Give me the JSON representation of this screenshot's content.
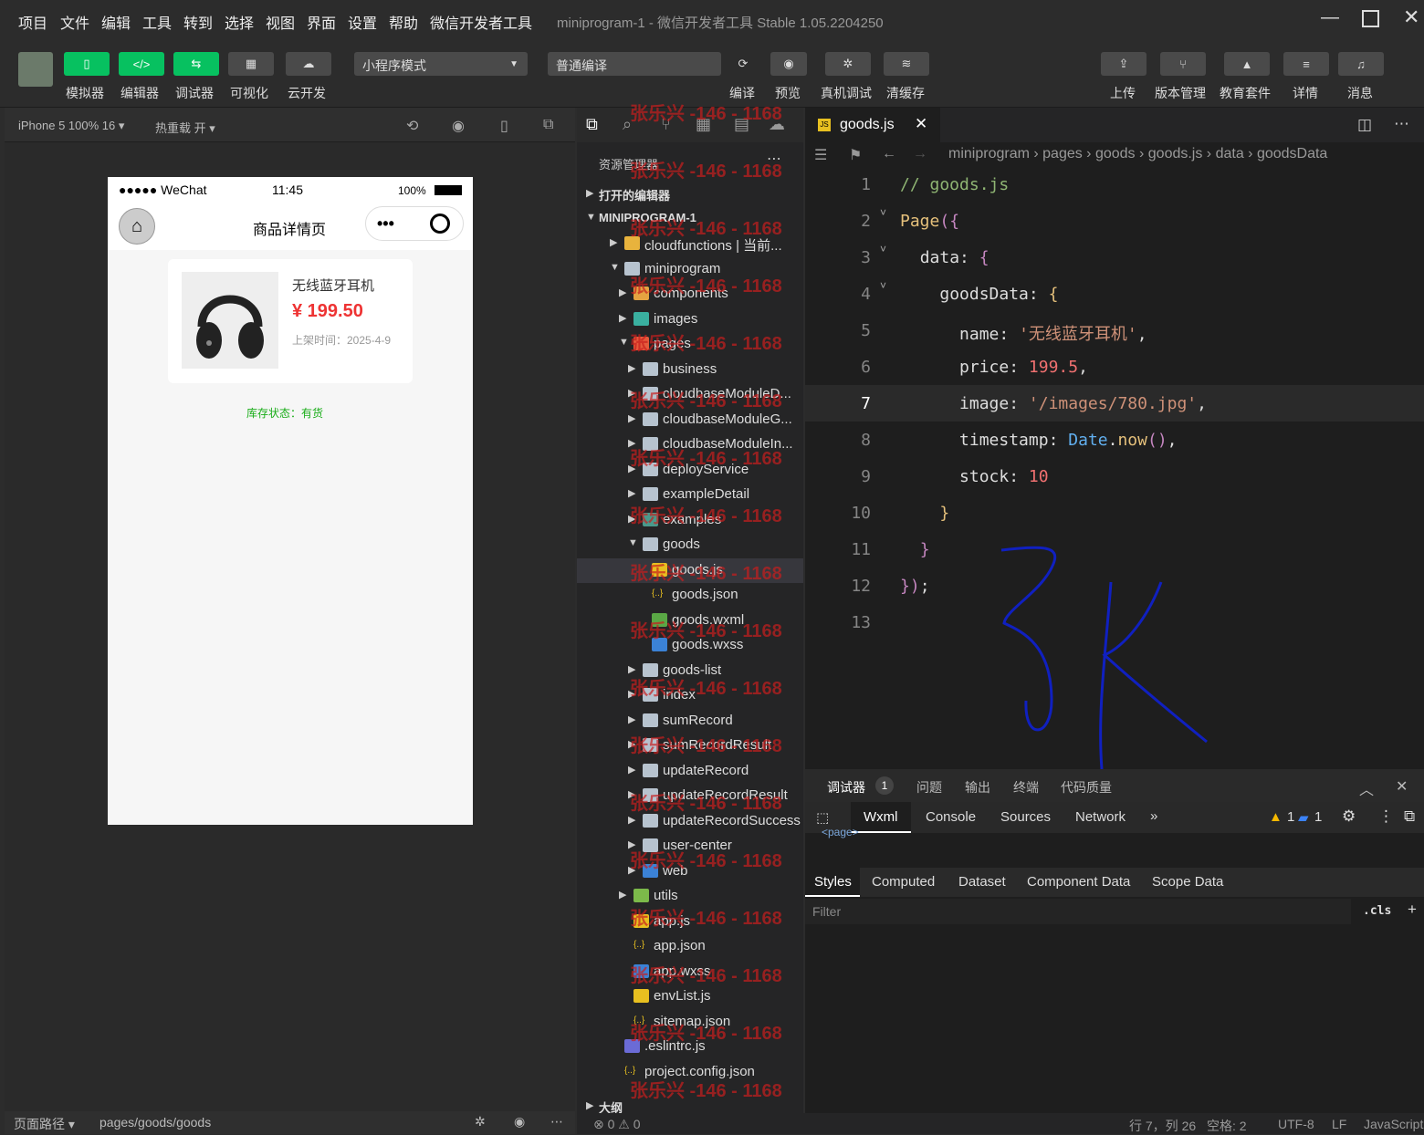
{
  "menubar": {
    "items": [
      "项目",
      "文件",
      "编辑",
      "工具",
      "转到",
      "选择",
      "视图",
      "界面",
      "设置",
      "帮助",
      "微信开发者工具"
    ],
    "window_title": "miniprogram-1 - 微信开发者工具 Stable 1.05.2204250"
  },
  "toolbar": {
    "left_buttons": [
      "模拟器",
      "编辑器",
      "调试器",
      "可视化",
      "云开发"
    ],
    "mode_select": "小程序模式",
    "compile_select": "普通编译",
    "mid_buttons": [
      "编译",
      "预览",
      "真机调试",
      "清缓存"
    ],
    "right_buttons": [
      "上传",
      "版本管理",
      "教育套件",
      "详情",
      "消息"
    ]
  },
  "simulator": {
    "device": "iPhone 5 100% 16",
    "hot_reload": "热重载 开",
    "status_carrier": "●●●●● WeChat",
    "status_time": "11:45",
    "status_battery": "100%",
    "nav_title": "商品详情页",
    "product": {
      "name": "无线蓝牙耳机",
      "price": "¥ 199.50",
      "listed": "上架时间：2025-4-9"
    },
    "stock_status": "库存状态：有货",
    "bottom_path_label": "页面路径",
    "bottom_path": "pages/goods/goods"
  },
  "explorer": {
    "title": "资源管理器",
    "open_editors": "打开的编辑器",
    "project": "MINIPROGRAM-1",
    "outline": "大纲",
    "rows": [
      {
        "label": "cloudfunctions | 当前...",
        "indent": 1,
        "arrow": "▶",
        "icon": "#e8b33d"
      },
      {
        "label": "miniprogram",
        "indent": 1,
        "arrow": "▼",
        "icon": "#b7c3cf"
      },
      {
        "label": "components",
        "indent": 2,
        "arrow": "▶",
        "icon": "#e5a341"
      },
      {
        "label": "images",
        "indent": 2,
        "arrow": "▶",
        "icon": "#3ab0a0"
      },
      {
        "label": "pages",
        "indent": 2,
        "arrow": "▼",
        "icon": "#e55a3b"
      },
      {
        "label": "business",
        "indent": 3,
        "arrow": "▶",
        "icon": "#b7c3cf"
      },
      {
        "label": "cloudbaseModuleD...",
        "indent": 3,
        "arrow": "▶",
        "icon": "#b7c3cf"
      },
      {
        "label": "cloudbaseModuleG...",
        "indent": 3,
        "arrow": "▶",
        "icon": "#b7c3cf"
      },
      {
        "label": "cloudbaseModuleIn...",
        "indent": 3,
        "arrow": "▶",
        "icon": "#b7c3cf"
      },
      {
        "label": "deployService",
        "indent": 3,
        "arrow": "▶",
        "icon": "#b7c3cf"
      },
      {
        "label": "exampleDetail",
        "indent": 3,
        "arrow": "▶",
        "icon": "#b7c3cf"
      },
      {
        "label": "examples",
        "indent": 3,
        "arrow": "▶",
        "icon": "#4a9a8c"
      },
      {
        "label": "goods",
        "indent": 3,
        "arrow": "▼",
        "icon": "#b7c3cf"
      },
      {
        "label": "goods.js",
        "indent": 4,
        "arrow": "",
        "icon": "#e8c020"
      },
      {
        "label": "goods.json",
        "indent": 4,
        "arrow": "",
        "icon": ""
      },
      {
        "label": "goods.wxml",
        "indent": 4,
        "arrow": "",
        "icon": "#5aa845"
      },
      {
        "label": "goods.wxss",
        "indent": 4,
        "arrow": "",
        "icon": "#3b82d6"
      },
      {
        "label": "goods-list",
        "indent": 3,
        "arrow": "▶",
        "icon": "#b7c3cf"
      },
      {
        "label": "index",
        "indent": 3,
        "arrow": "▶",
        "icon": "#b7c3cf"
      },
      {
        "label": "sumRecord",
        "indent": 3,
        "arrow": "▶",
        "icon": "#b7c3cf"
      },
      {
        "label": "sumRecordResult",
        "indent": 3,
        "arrow": "▶",
        "icon": "#b7c3cf"
      },
      {
        "label": "updateRecord",
        "indent": 3,
        "arrow": "▶",
        "icon": "#b7c3cf"
      },
      {
        "label": "updateRecordResult",
        "indent": 3,
        "arrow": "▶",
        "icon": "#b7c3cf"
      },
      {
        "label": "updateRecordSuccess",
        "indent": 3,
        "arrow": "▶",
        "icon": "#b7c3cf"
      },
      {
        "label": "user-center",
        "indent": 3,
        "arrow": "▶",
        "icon": "#b7c3cf"
      },
      {
        "label": "web",
        "indent": 3,
        "arrow": "▶",
        "icon": "#3b82d6"
      },
      {
        "label": "utils",
        "indent": 2,
        "arrow": "▶",
        "icon": "#7cba4a"
      },
      {
        "label": "app.js",
        "indent": 2,
        "arrow": "",
        "icon": "#e8c020"
      },
      {
        "label": "app.json",
        "indent": 2,
        "arrow": "",
        "icon": ""
      },
      {
        "label": "app.wxss",
        "indent": 2,
        "arrow": "",
        "icon": "#3b82d6"
      },
      {
        "label": "envList.js",
        "indent": 2,
        "arrow": "",
        "icon": "#e8c020"
      },
      {
        "label": "sitemap.json",
        "indent": 2,
        "arrow": "",
        "icon": ""
      },
      {
        "label": ".eslintrc.js",
        "indent": 1,
        "arrow": "",
        "icon": "#6b6bd6"
      },
      {
        "label": "project.config.json",
        "indent": 1,
        "arrow": "",
        "icon": ""
      }
    ],
    "watermark": "张乐兴 -146 - 1168"
  },
  "editor": {
    "tab": "goods.js",
    "breadcrumb": [
      "miniprogram",
      "pages",
      "goods",
      "goods.js",
      "data",
      "goodsData"
    ],
    "cursor_line": 7
  },
  "devtools": {
    "top_tabs": [
      "调试器",
      "问题",
      "输出",
      "终端",
      "代码质量"
    ],
    "badge": "1",
    "sub_tabs": [
      "Wxml",
      "Console",
      "Sources",
      "Network"
    ],
    "warn_count": "1",
    "info_count": "1",
    "styles_tabs": [
      "Styles",
      "Computed",
      "Dataset",
      "Component Data",
      "Scope Data"
    ],
    "filter_placeholder": "Filter",
    "cls": ".cls",
    "page_tag": "<page>"
  },
  "statusbar": {
    "errors": "⊗ 0 ⚠ 0",
    "position": "行 7，列 26",
    "spaces": "空格: 2",
    "encoding": "UTF-8",
    "eol": "LF",
    "language": "JavaScript"
  }
}
